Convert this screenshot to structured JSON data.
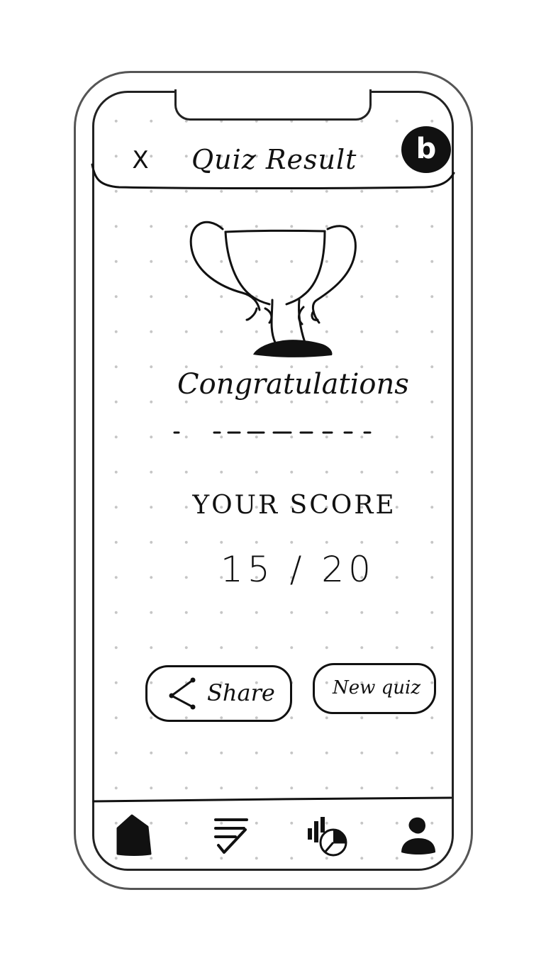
{
  "header": {
    "close_symbol": "X",
    "title": "Quiz Result",
    "avatar_initial": "b"
  },
  "result": {
    "heading": "Congratulations",
    "score_label": "YOUR SCORE",
    "score": "15 / 20"
  },
  "actions": {
    "share_label": "Share",
    "new_quiz_label": "New quiz"
  },
  "tab_bar": {
    "items": [
      {
        "icon": "home-icon",
        "active": true
      },
      {
        "icon": "quiz-list-icon"
      },
      {
        "icon": "stats-icon"
      },
      {
        "icon": "profile-icon"
      }
    ]
  },
  "colors": {
    "ink": "#111111",
    "frame": "#555555",
    "grid_dot": "#c6c6c6",
    "background": "#ffffff"
  }
}
